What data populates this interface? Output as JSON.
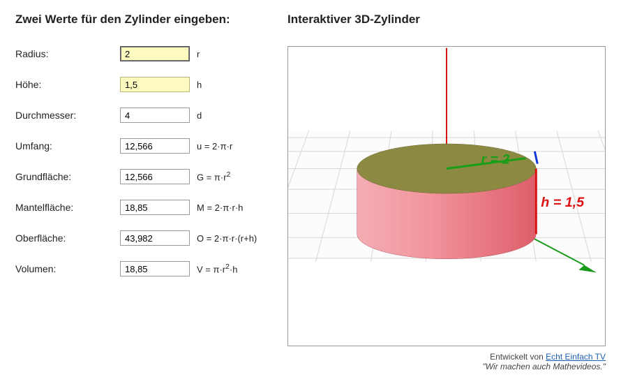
{
  "form": {
    "heading": "Zwei Werte für den Zylinder eingeben:",
    "rows": {
      "radius": {
        "label": "Radius:",
        "value": "2",
        "unit": "r",
        "highlight": true,
        "active": true
      },
      "hoehe": {
        "label": "Höhe:",
        "value": "1,5",
        "unit": "h",
        "highlight": true
      },
      "durchm": {
        "label": "Durchmesser:",
        "value": "4",
        "unit": "d"
      },
      "umfang": {
        "label": "Umfang:",
        "value": "12,566",
        "unit": "u = 2·π·r"
      },
      "grundfl": {
        "label": "Grundfläche:",
        "value": "12,566",
        "unit": "G = π·r²"
      },
      "mantel": {
        "label": "Mantelfläche:",
        "value": "18,85",
        "unit": "M = 2·π·r·h"
      },
      "oberfl": {
        "label": "Oberfläche:",
        "value": "43,982",
        "unit": "O = 2·π·r·(r+h)"
      },
      "volumen": {
        "label": "Volumen:",
        "value": "18,85",
        "unit": "V = π·r²·h"
      }
    }
  },
  "viz": {
    "heading": "Interaktiver 3D-Zylinder",
    "label_r": "r = 2",
    "label_h": "h = 1,5"
  },
  "footer": {
    "prefix": "Entwickelt von ",
    "link": "Echt Einfach TV",
    "tagline": "\"Wir machen auch Mathevideos.\""
  }
}
